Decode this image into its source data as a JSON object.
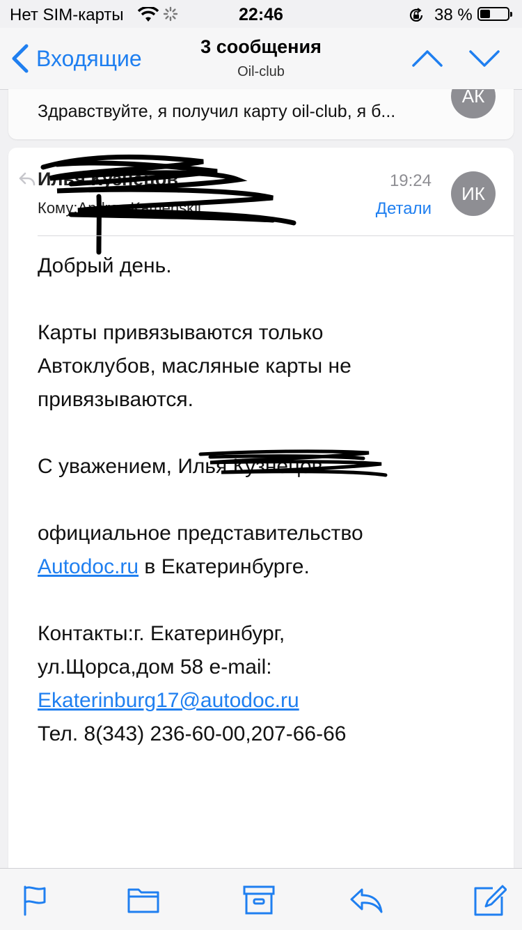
{
  "status_bar": {
    "carrier": "Нет SIM-карты",
    "time": "22:46",
    "battery_percent": "38 %",
    "battery_level": 0.38
  },
  "nav": {
    "back_label": "Входящие",
    "title": "3 сообщения",
    "subtitle": "Oil-club"
  },
  "previous_message": {
    "snippet": "Здравствуйте, я получил карту oil-club, я б...",
    "avatar_initials": "АК"
  },
  "message": {
    "sender": "Илья Кузнецов",
    "to_label": "Кому:",
    "to_value": "Andrey Kamenskii",
    "time": "19:24",
    "details_label": "Детали",
    "avatar_initials": "ИК",
    "greeting": "Добрый день.",
    "body_line1": "Карты привязываются только",
    "body_line2": "Автоклубов, масляные карты не",
    "body_line3": "привязываются.",
    "regards": "С уважением, ",
    "regards_name": "Илья Кузнецов",
    "org_line1": "официальное представительство",
    "org_link": "Autodoc.ru",
    "org_line2_rest": " в Екатеринбурге.",
    "contacts_line1": "Контакты:г. Екатеринбург,",
    "contacts_line2": "ул.Щорса,дом 58 e-mail:",
    "email": "Ekaterinburg17@autodoc.ru",
    "phone": "Тел. 8(343) 236-60-00,207-66-66"
  },
  "colors": {
    "accent": "#1f7ff0",
    "avatar": "#8e8e93",
    "background": "#f1f1f3"
  },
  "toolbar": {
    "icons": [
      "flag-icon",
      "folder-icon",
      "archive-icon",
      "reply-icon",
      "compose-icon"
    ]
  }
}
